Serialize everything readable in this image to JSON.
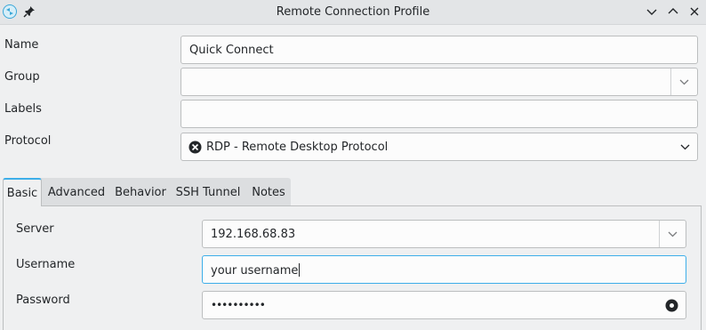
{
  "window": {
    "title": "Remote Connection Profile",
    "app_icon": "remmina-icon",
    "pin_icon": "pin-icon",
    "buttons": [
      "minimize",
      "maximize",
      "close"
    ]
  },
  "form": {
    "name": {
      "label": "Name",
      "value": "Quick Connect"
    },
    "group": {
      "label": "Group",
      "value": ""
    },
    "labels": {
      "label": "Labels",
      "value": ""
    },
    "protocol": {
      "label": "Protocol",
      "value": "RDP - Remote Desktop Protocol",
      "icon": "rdp-icon"
    }
  },
  "tabs": [
    {
      "label": "Basic",
      "active": true
    },
    {
      "label": "Advanced"
    },
    {
      "label": "Behavior"
    },
    {
      "label": "SSH Tunnel"
    },
    {
      "label": "Notes"
    }
  ],
  "basic": {
    "server": {
      "label": "Server",
      "value": "192.168.68.83"
    },
    "username": {
      "label": "Username",
      "value": "your username"
    },
    "password": {
      "label": "Password",
      "value": "••••••••••",
      "icon": "reveal-password-icon"
    }
  },
  "colors": {
    "accent": "#3daee9",
    "background": "#eff0f1",
    "field": "#fcfcfc"
  }
}
